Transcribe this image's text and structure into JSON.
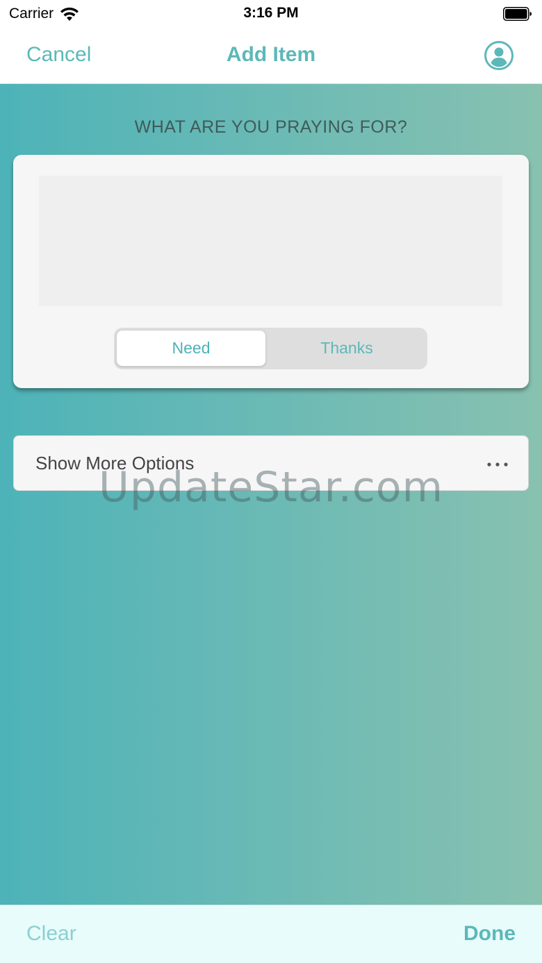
{
  "status_bar": {
    "carrier": "Carrier",
    "time": "3:16 PM",
    "icons": [
      "wifi-icon",
      "battery-icon"
    ]
  },
  "nav": {
    "cancel_label": "Cancel",
    "title": "Add Item",
    "profile_icon": "person-circle-icon"
  },
  "form": {
    "prompt": "WHAT ARE YOU PRAYING FOR?",
    "input_value": "",
    "segments": [
      {
        "label": "Need",
        "selected": true
      },
      {
        "label": "Thanks",
        "selected": false
      }
    ]
  },
  "options": {
    "label": "Show More Options",
    "icon": "ellipsis-icon"
  },
  "watermark": "UpdateStar.com",
  "bottom_bar": {
    "clear_label": "Clear",
    "done_label": "Done"
  },
  "colors": {
    "accent": "#5cb8b8",
    "gradient_start": "#4db3b8",
    "gradient_end": "#88c1b0",
    "bottom_bar_bg": "#e8fcfc"
  }
}
